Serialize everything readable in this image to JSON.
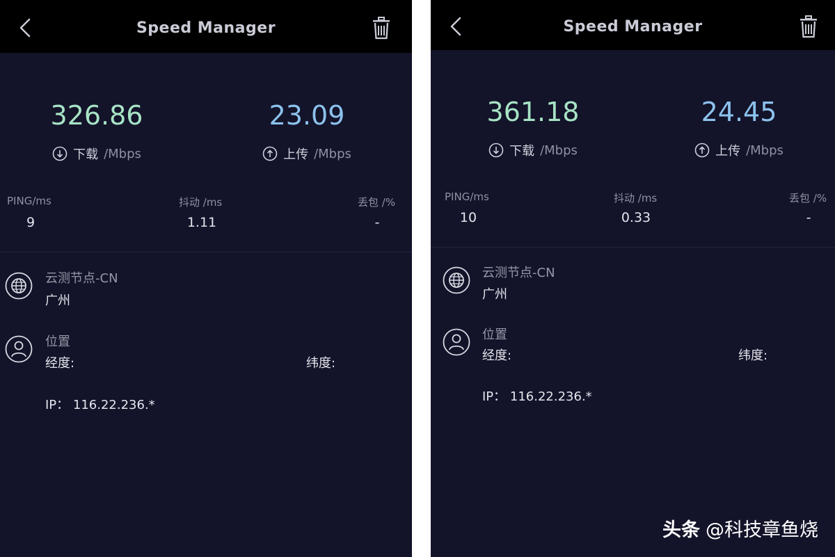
{
  "colors": {
    "background": "#13132a",
    "header": "#000000",
    "download": "#a7e3c5",
    "upload": "#8cc2ec"
  },
  "icons": {
    "back": "chevron-left-icon",
    "trash": "trash-icon",
    "download": "arrow-down-circle-icon",
    "upload": "arrow-up-circle-icon",
    "node": "globe-icon",
    "location": "user-icon"
  },
  "panels": [
    {
      "title": "Speed Manager",
      "download_value": "326.86",
      "download_label": "下载",
      "download_unit": "/Mbps",
      "upload_value": "23.09",
      "upload_label": "上传",
      "upload_unit": "/Mbps",
      "ping_label": "PING/ms",
      "ping_value": "9",
      "jitter_label": "抖动 /ms",
      "jitter_value": "1.11",
      "loss_label": "丢包 /%",
      "loss_value": "-",
      "node_title": "云测节点-CN",
      "node_city": "广州",
      "location_title": "位置",
      "longitude_label": "经度:",
      "latitude_label": "纬度:",
      "ip_text": "IP： 116.22.236.*"
    },
    {
      "title": "Speed Manager",
      "download_value": "361.18",
      "download_label": "下载",
      "download_unit": "/Mbps",
      "upload_value": "24.45",
      "upload_label": "上传",
      "upload_unit": "/Mbps",
      "ping_label": "PING/ms",
      "ping_value": "10",
      "jitter_label": "抖动 /ms",
      "jitter_value": "0.33",
      "loss_label": "丢包 /%",
      "loss_value": "-",
      "node_title": "云测节点-CN",
      "node_city": "广州",
      "location_title": "位置",
      "longitude_label": "经度:",
      "latitude_label": "纬度:",
      "ip_text": "IP： 116.22.236.*"
    }
  ],
  "watermark": {
    "brand": "头条",
    "handle": "@科技章鱼烧"
  }
}
